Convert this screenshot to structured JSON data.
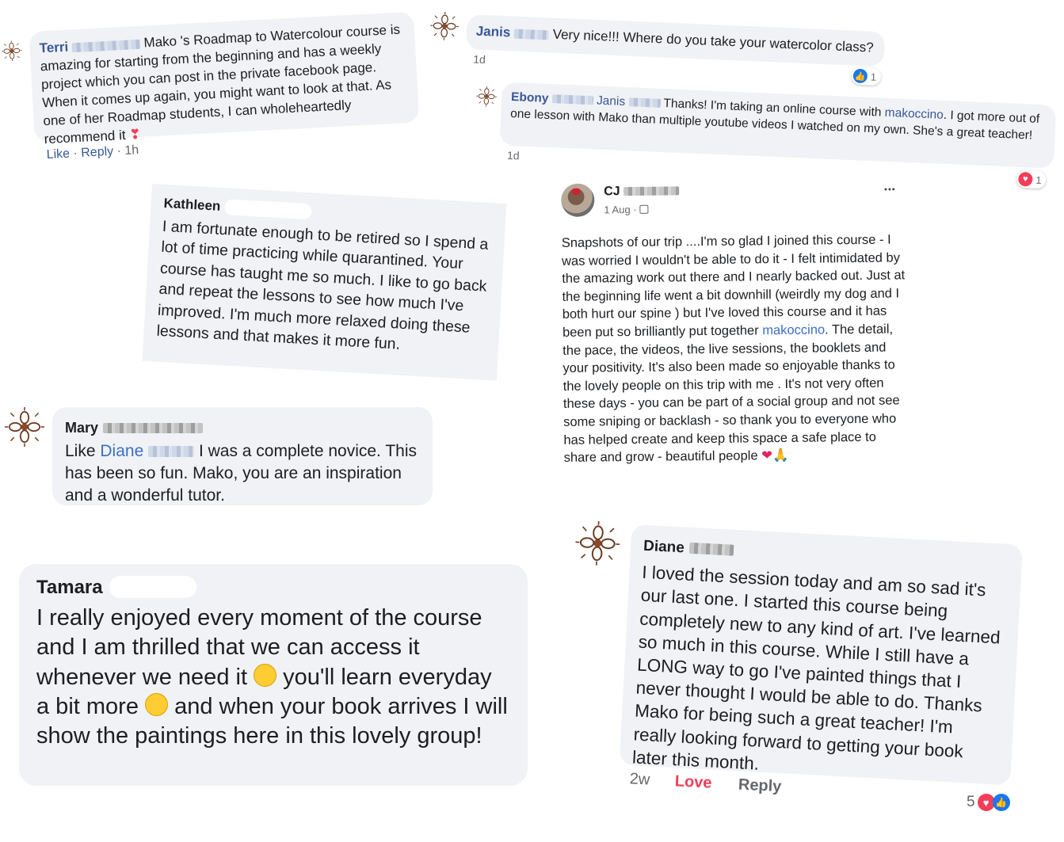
{
  "c1": {
    "name": "Terri",
    "text": "Mako 's Roadmap to Watercolour course is amazing for starting from the beginning and has a weekly project which you can post in the private facebook page. When it comes up again, you might want to look at that. As one of her Roadmap students, I can wholeheartedly recommend it",
    "like": "Like",
    "sep": "·",
    "reply": "Reply",
    "time": "1h",
    "emoji": "❣"
  },
  "c2": {
    "name": "Janis",
    "text": "Very nice!!! Where do you take your watercolor class?",
    "time": "1d",
    "reaction_count": "1"
  },
  "c3": {
    "name": "Ebony",
    "tag": "Janis",
    "text_a": "Thanks! I'm taking an online course with",
    "link": "makoccino",
    "text_b": ". I got more out of one lesson with Mako than multiple youtube videos I watched on my own. She's a great teacher!",
    "time": "1d",
    "reaction_count": "1"
  },
  "c4": {
    "name": "Kathleen",
    "text": "I am fortunate enough to be retired so I spend a lot of time practicing while quarantined. Your course has taught me so much. I like to go back and repeat the lessons to see how much I've improved. I'm much more relaxed doing these lessons and that makes it more fun."
  },
  "c5": {
    "name": "CJ",
    "date": "1 Aug",
    "sep": "·",
    "more": "•••",
    "text_a": "Snapshots of our trip ....I'm so glad I joined this course - I was worried I wouldn't be able to do it - I felt intimidated by the amazing work out there and I nearly backed out. Just at the beginning life went a bit downhill (weirdly my dog and I both hurt our spine ) but I've loved this course and it has been put so brilliantly put together",
    "link": "makoccino",
    "text_b": ". The detail, the pace, the videos,  the live sessions, the booklets and your positivity.  It's also been made so enjoyable thanks to the lovely people on this trip with me . It's not very often these days - you can be part of a social group and not see some sniping or backlash - so thank you to everyone who has helped create and keep this space a safe place to share and grow - beautiful people",
    "emoji": "❤🙏"
  },
  "c6": {
    "name": "Mary",
    "text_a": "Like",
    "tag": "Diane",
    "text_b": "I was a complete novice. This has been so fun. Mako, you are an inspiration and a wonderful tutor."
  },
  "c7": {
    "name": "Diane",
    "text": "I loved the session today and am so sad it's our last one. I started this course being completely new to any kind of art. I've learned so much in this course. While I still have a LONG way to go I've painted things that I never thought I would be able to do. Thanks Mako for being such a great teacher! I'm really looking forward to getting your book later this month.",
    "time": "2w",
    "love": "Love",
    "reply": "Reply",
    "reaction_count": "5"
  },
  "c8": {
    "name": "Tamara",
    "text_a": "I really enjoyed every moment of the course and I am thrilled that we can access it whenever we need it",
    "text_b": "you'll learn everyday a bit more",
    "text_c": "and when your book arrives I will show the paintings here in this lovely group!"
  },
  "colors": {
    "link": "#385898",
    "bubble": "#f0f2f5",
    "love": "#f33e58",
    "like": "#1877f2"
  },
  "icons": [
    "flower-avatar-icon",
    "like-icon",
    "love-icon",
    "more-icon",
    "globe-icon",
    "smile-emoji-icon",
    "wink-emoji-icon",
    "heart-emoji-icon"
  ]
}
